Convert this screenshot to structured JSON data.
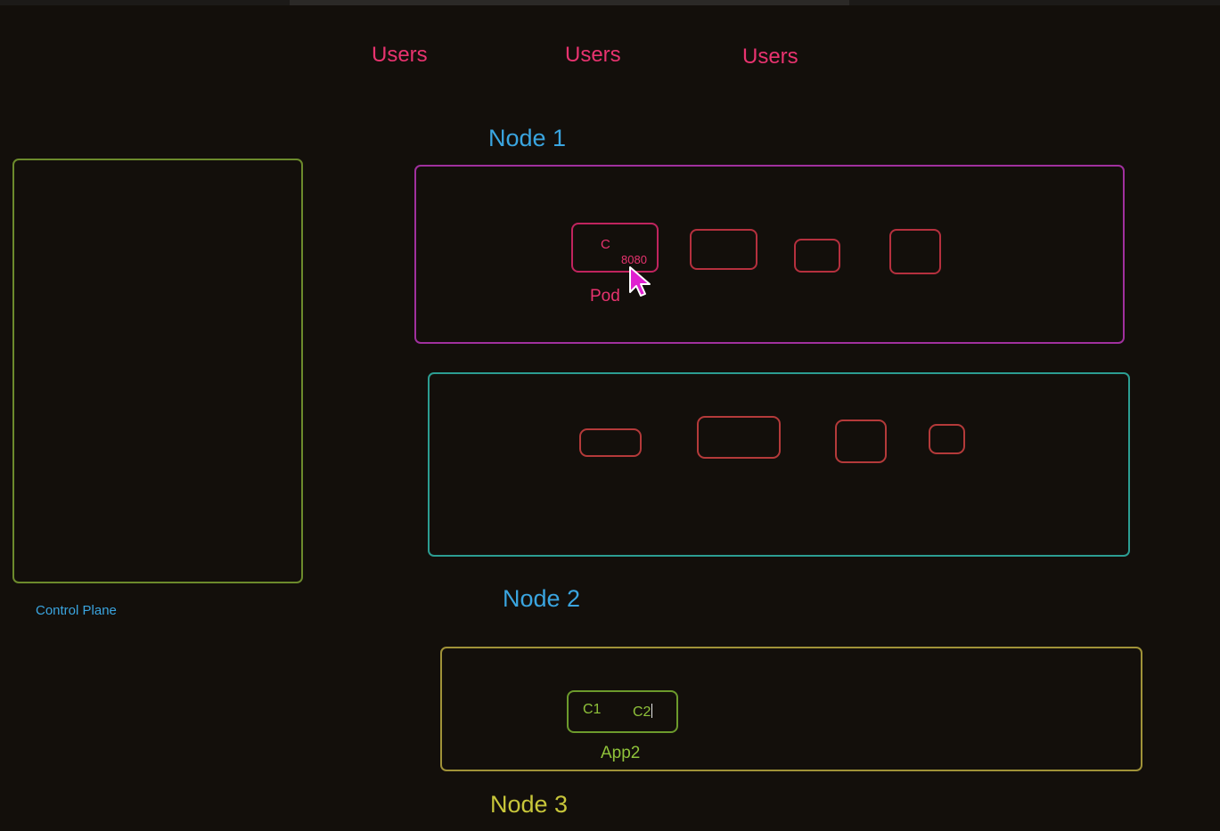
{
  "users": [
    "Users",
    "Users",
    "Users"
  ],
  "control_plane": {
    "label": "Control Plane"
  },
  "node1": {
    "label": "Node 1",
    "pod": {
      "container": "C",
      "port": "8080",
      "label": "Pod"
    }
  },
  "node2": {
    "label": "Node 2"
  },
  "node3": {
    "label": "Node 3",
    "app": {
      "c1": "C1",
      "c2": "C2",
      "label": "App2"
    }
  },
  "colors": {
    "background": "#130f0b",
    "users": "#e8336f",
    "node_label": "#3aa5e0",
    "node3_label": "#c8c63a",
    "control_plane_border": "#6c8a2c",
    "node1_border": "#a0309e",
    "node2_border": "#2c9d92",
    "node3_border": "#a09238",
    "cursor": "#e020d0"
  },
  "icons": {
    "cursor": "mouse-pointer-icon"
  }
}
